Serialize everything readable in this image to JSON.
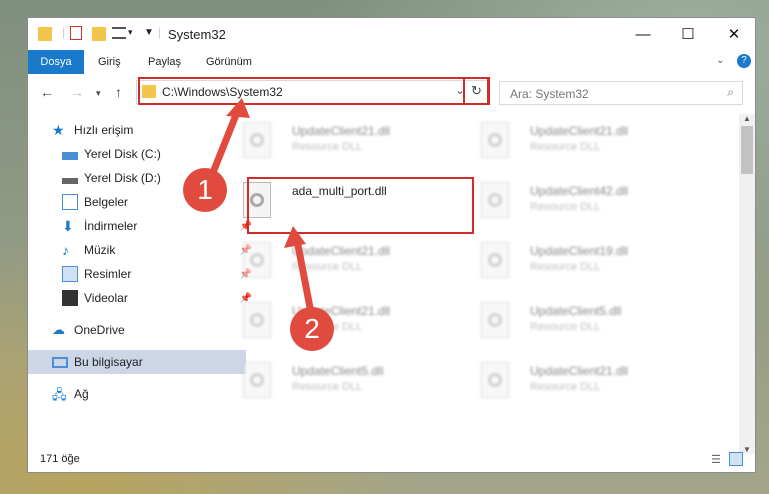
{
  "window": {
    "title": "System32"
  },
  "ribbon": {
    "tabs": [
      "Dosya",
      "Giriş",
      "Paylaş",
      "Görünüm"
    ]
  },
  "address": {
    "path": "C:\\Windows\\System32"
  },
  "search": {
    "placeholder": "Ara: System32"
  },
  "sidebar": {
    "items": [
      {
        "label": "Hızlı erişim"
      },
      {
        "label": "Yerel Disk (C:)"
      },
      {
        "label": "Yerel Disk (D:)"
      },
      {
        "label": "Belgeler"
      },
      {
        "label": "İndirmeler"
      },
      {
        "label": "Müzik"
      },
      {
        "label": "Resimler"
      },
      {
        "label": "Videolar"
      },
      {
        "label": "OneDrive"
      },
      {
        "label": "Bu bilgisayar"
      },
      {
        "label": "Ağ"
      }
    ]
  },
  "files": {
    "col1": [
      {
        "name": "UpdateClient21.dll",
        "desc": "Resource DLL"
      },
      {
        "name": "ada_multi_port.dll",
        "desc": ""
      },
      {
        "name": "UpdateClient21.dll",
        "desc": "Resource DLL"
      },
      {
        "name": "UpdateClient21.dll",
        "desc": "Resource DLL"
      },
      {
        "name": "UpdateClient5.dll",
        "desc": "Resource DLL"
      }
    ],
    "col2": [
      {
        "name": "UpdateClient21.dll",
        "desc": "Resource DLL"
      },
      {
        "name": "UpdateClient42.dll",
        "desc": "Resource DLL"
      },
      {
        "name": "UpdateClient19.dll",
        "desc": "Resource DLL"
      },
      {
        "name": "UpdateClient5.dll",
        "desc": "Resource DLL"
      },
      {
        "name": "UpdateClient21.dll",
        "desc": "Resource DLL"
      }
    ]
  },
  "status": {
    "count": "171 öğe"
  },
  "annotations": {
    "step1": "1",
    "step2": "2"
  },
  "colors": {
    "accent": "#1979ca",
    "highlight": "#d22b2b",
    "badge": "#e14b3f"
  }
}
